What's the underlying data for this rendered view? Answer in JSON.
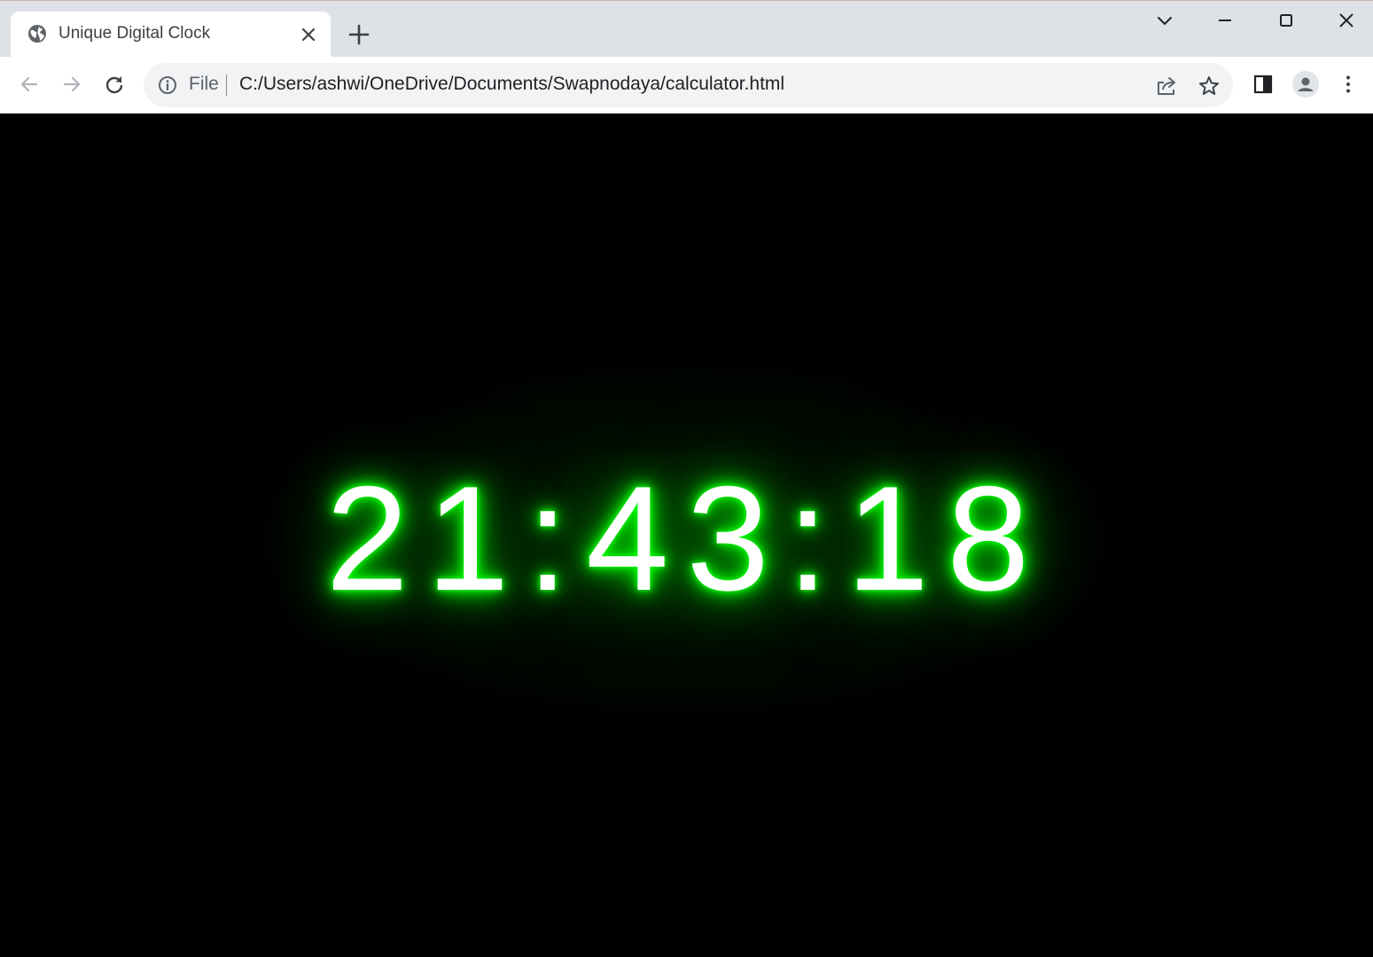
{
  "browser": {
    "tab": {
      "title": "Unique Digital Clock",
      "favicon": "globe-icon"
    },
    "window_controls": [
      "tab-search-icon",
      "minimize-icon",
      "maximize-icon",
      "close-icon"
    ],
    "toolbar": {
      "back": "arrow-left-icon",
      "forward": "arrow-right-icon",
      "reload": "reload-icon"
    },
    "omnibox": {
      "scheme_label": "File",
      "url": "C:/Users/ashwi/OneDrive/Documents/Swapnodaya/calculator.html",
      "share": "share-icon",
      "bookmark": "star-icon"
    },
    "side_panel": "side-panel-icon",
    "profile": "profile-avatar-icon",
    "menu": "more-vert-icon"
  },
  "page": {
    "clock_time": "21:43:18",
    "background_color": "#000000",
    "glow_color": "#00ff00",
    "text_color": "#ffffff"
  }
}
